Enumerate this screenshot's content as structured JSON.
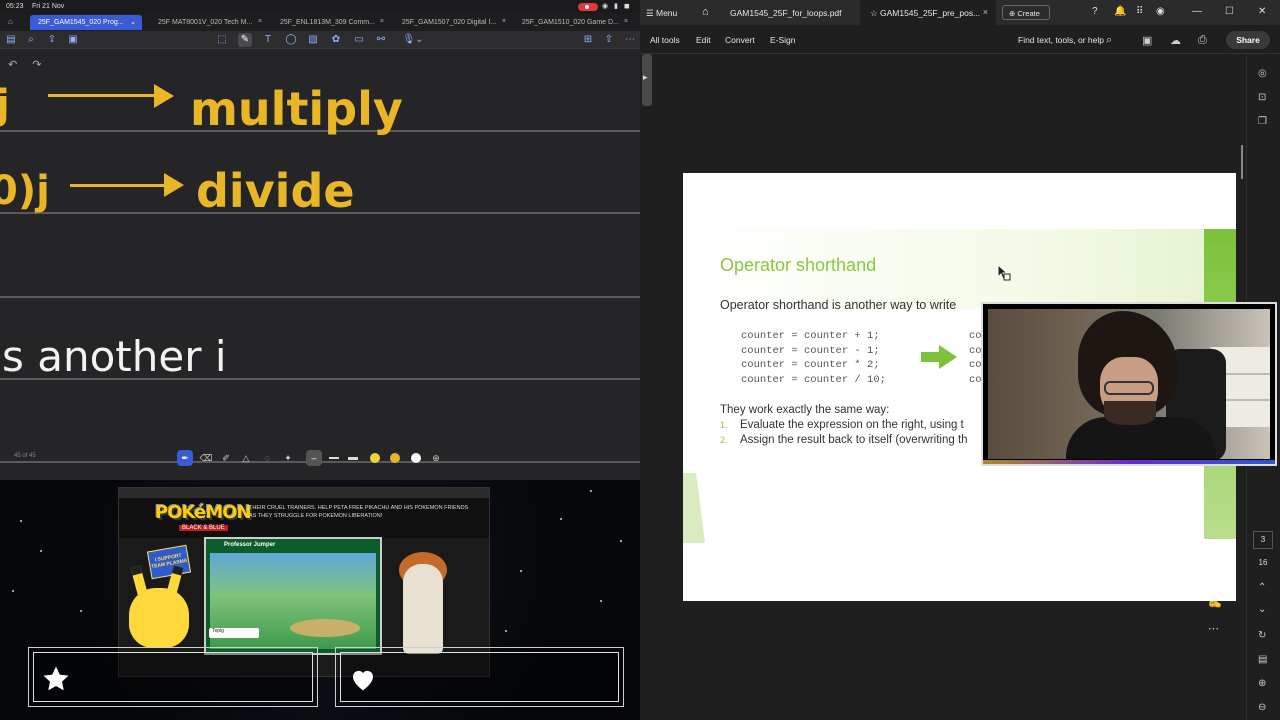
{
  "tablet": {
    "status": {
      "time": "05:23",
      "date": "Fri 21 Nov"
    },
    "tabs": [
      {
        "label": "25F_GAM1545_020 Prog...",
        "active": true
      },
      {
        "label": "25F MAT8001V_020 Tech M...",
        "active": false
      },
      {
        "label": "25F_ENL1813M_309 Comm...",
        "active": false
      },
      {
        "label": "25F_GAM1507_020 Digital I...",
        "active": false
      },
      {
        "label": "25F_GAM1510_020 Game D...",
        "active": false
      }
    ],
    "toolbar_icons": [
      "sidebar-icon",
      "search-icon",
      "share-icon",
      "bookmark-icon",
      "lasso-icon",
      "pen-icon",
      "text-icon",
      "shapes-icon",
      "image-icon",
      "sticker-icon",
      "note-icon",
      "link-icon",
      "mic-icon",
      "add-page-icon",
      "export-icon",
      "more-icon"
    ],
    "undo_glyph": "↶",
    "redo_glyph": "↷",
    "handwriting": {
      "line1_prefix": "j",
      "line1_word": "multiply",
      "line2_prefix": "0)j",
      "line2_word": "divide",
      "line3": "s another i"
    },
    "page_counter": "45 of 45",
    "pen_colors": [
      "#f2d23a",
      "#e9b628",
      "#ffffff"
    ]
  },
  "game": {
    "logo": "POKéMON",
    "logo_sub": "BLACK & BLUE",
    "tagline": "THEIR CRUEL TRAINERS. HELP PETA FREE PIKACHU AND HIS POKEMON FRIENDS AS THEY STRUGGLE FOR POKEMON LIBERATION!",
    "trainer_name": "Professor Jumper",
    "sign_text": "I SUPPORT TEAM PLASMA",
    "hud_text": "Tepig"
  },
  "alerts": [
    {
      "icon": "star-icon"
    },
    {
      "icon": "heart-icon"
    },
    {
      "icon": "add-user-icon"
    },
    {
      "icon": "dollar-icon"
    }
  ],
  "pdf": {
    "menu_label": "Menu",
    "tabs": [
      {
        "label": "GAM1545_25F_for_loops.pdf",
        "active": false
      },
      {
        "label": "GAM1545_25F_pre_pos...",
        "active": true
      }
    ],
    "create_label": "Create",
    "menubar": [
      "All tools",
      "Edit",
      "Convert",
      "E-Sign"
    ],
    "find_placeholder": "Find text, tools, or help",
    "share_label": "Share",
    "page_current": "3",
    "page_total": "16",
    "slide": {
      "title": "Operator shorthand",
      "intro": "Operator shorthand is another way to write",
      "code_left": [
        "counter = counter + 1;",
        "counter = counter - 1;",
        "counter = counter * 2;",
        "counter = counter / 10;"
      ],
      "code_right_partial": [
        "co",
        "co",
        "co",
        "co"
      ],
      "sub": "They work exactly the same way:",
      "list": [
        {
          "n": "1.",
          "text": "Evaluate the expression on the right, using t"
        },
        {
          "n": "2.",
          "text": "Assign the result back to itself (overwriting th"
        }
      ]
    },
    "accent_color": "#8cc63f"
  }
}
